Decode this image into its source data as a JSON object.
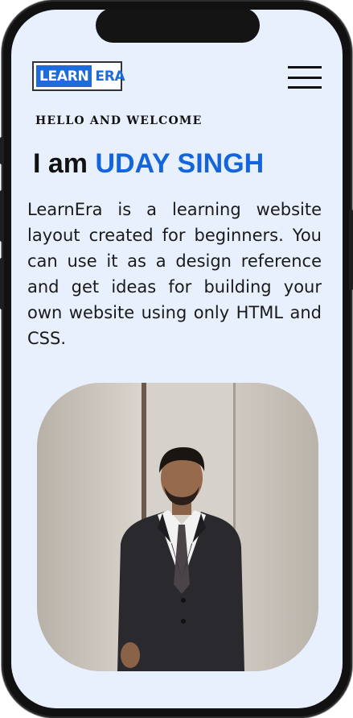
{
  "header": {
    "logo_part1": "LEARN",
    "logo_part2": "ERA",
    "menu_icon": "hamburger-menu-icon"
  },
  "hero": {
    "greeting": "HELLO AND WELCOME",
    "heading_prefix": "I am",
    "heading_name": "UDAY SINGH",
    "intro": "LearnEra is a learning website layout created for beginners. You can use it as a design reference and get ideas for building your own website using only HTML and CSS."
  },
  "colors": {
    "accent": "#1464dc",
    "logo_blue": "#1f6bd8",
    "background": "#e8f0fd",
    "text": "#111111"
  }
}
